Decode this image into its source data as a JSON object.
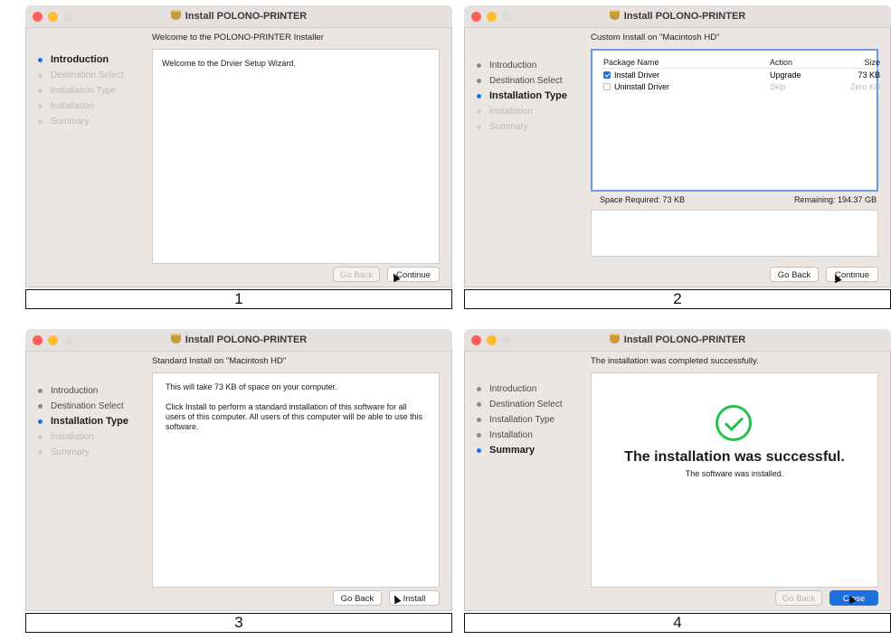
{
  "window_title": "Install POLONO-PRINTER",
  "steps": [
    "Introduction",
    "Destination Select",
    "Installation Type",
    "Installation",
    "Summary"
  ],
  "panels": [
    {
      "caption": "1",
      "header": "Welcome to the POLONO-PRINTER Installer",
      "body": "Welcome to the Drvier Setup Wizard.",
      "back_label": "Go Back",
      "next_label": "Continue"
    },
    {
      "caption": "2",
      "header": "Custom Install on \"Macintosh HD\"",
      "columns": [
        "Package Name",
        "Action",
        "Size"
      ],
      "rows": [
        {
          "name": "Install Driver",
          "action": "Upgrade",
          "size": "73 KB"
        },
        {
          "name": "Uninstall Driver",
          "action": "Skip",
          "size": "Zero KB"
        }
      ],
      "space_required": "Space Required:  73 KB",
      "remaining": "Remaining:  194.37 GB",
      "back_label": "Go Back",
      "next_label": "Continue"
    },
    {
      "caption": "3",
      "header": "Standard Install on \"Macintosh HD\"",
      "line1": "This will take 73 KB of space on your computer.",
      "line2": "Click Install to perform a standard installation of this software for all users of this computer. All users of this computer will be able to use this software.",
      "back_label": "Go Back",
      "next_label": "Install"
    },
    {
      "caption": "4",
      "header": "The installation was completed successfully.",
      "big": "The installation was successful.",
      "small": "The software was installed.",
      "back_label": "Go Back",
      "next_label": "Close"
    }
  ],
  "colors": {
    "accent": "#1e6fe0",
    "success": "#27c24c",
    "close_light": "#ff5f57",
    "min_light": "#febc2e",
    "max_light": "#dcdcdc"
  },
  "icons": [
    "package-icon",
    "checkmark-circle-icon",
    "checkbox-icon",
    "cursor-icon"
  ]
}
